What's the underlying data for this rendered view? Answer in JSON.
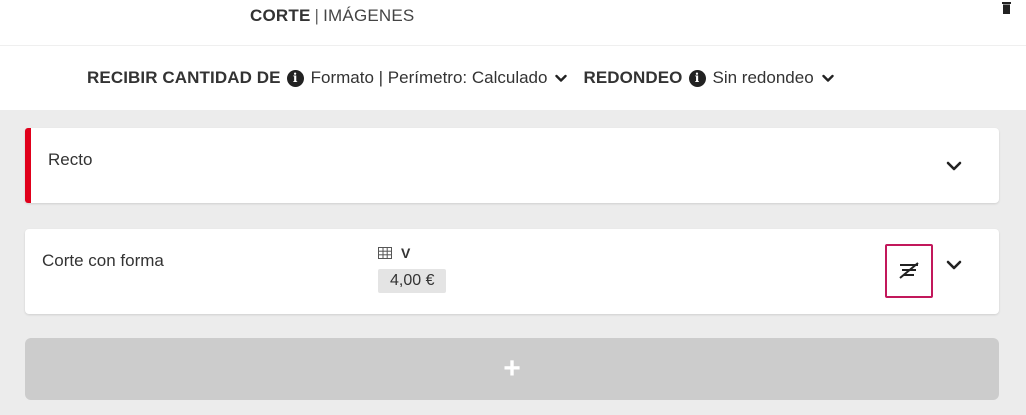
{
  "tabs": {
    "active": "CORTE",
    "separator": "|",
    "images": "IMÁGENES"
  },
  "options": {
    "receive_label": "RECIBIR CANTIDAD DE",
    "receive_value": "Formato | Perímetro: Calculado",
    "rounding_label": "REDONDEO",
    "rounding_value": "Sin redondeo",
    "info_glyph": "i"
  },
  "cards": [
    {
      "title": "Recto",
      "accent_color": "#e0001b"
    },
    {
      "title": "Corte con forma",
      "variant": "V",
      "price": "4,00 €"
    }
  ],
  "add_button": {
    "label": "+"
  },
  "colors": {
    "accent_red": "#e0001b",
    "highlight_magenta": "#c2185b",
    "panel_gray": "#ececec",
    "add_gray": "#cccccc"
  },
  "icons": [
    "trash-icon",
    "info-icon",
    "chevron-down-icon",
    "grid-icon",
    "no-filter-icon",
    "plus-icon"
  ]
}
